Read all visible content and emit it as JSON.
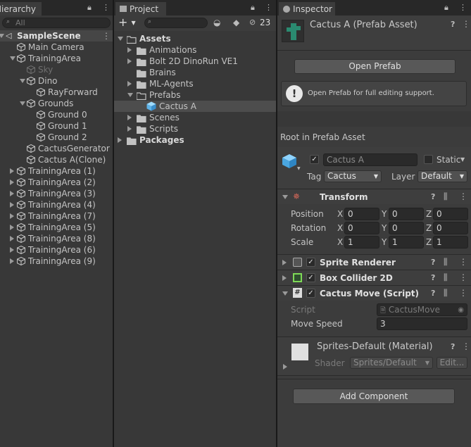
{
  "hierarchy": {
    "tab_title": "Hierarchy",
    "search_placeholder": "All",
    "scene_name": "SampleScene",
    "items": [
      {
        "label": "Main Camera",
        "indent": 1,
        "arrow": "",
        "dim": false
      },
      {
        "label": "TrainingArea",
        "indent": 1,
        "arrow": "down",
        "dim": false
      },
      {
        "label": "Sky",
        "indent": 2,
        "arrow": "",
        "dim": true
      },
      {
        "label": "Dino",
        "indent": 2,
        "arrow": "down",
        "dim": false
      },
      {
        "label": "RayForward",
        "indent": 3,
        "arrow": "",
        "dim": false
      },
      {
        "label": "Grounds",
        "indent": 2,
        "arrow": "down",
        "dim": false
      },
      {
        "label": "Ground 0",
        "indent": 3,
        "arrow": "",
        "dim": false
      },
      {
        "label": "Ground 1",
        "indent": 3,
        "arrow": "",
        "dim": false
      },
      {
        "label": "Ground 2",
        "indent": 3,
        "arrow": "",
        "dim": false
      },
      {
        "label": "CactusGenerator",
        "indent": 2,
        "arrow": "",
        "dim": false
      },
      {
        "label": "Cactus A(Clone)",
        "indent": 2,
        "arrow": "",
        "dim": false
      },
      {
        "label": "TrainingArea (1)",
        "indent": 1,
        "arrow": "right",
        "dim": false
      },
      {
        "label": "TrainingArea (2)",
        "indent": 1,
        "arrow": "right",
        "dim": false
      },
      {
        "label": "TrainingArea (3)",
        "indent": 1,
        "arrow": "right",
        "dim": false
      },
      {
        "label": "TrainingArea (4)",
        "indent": 1,
        "arrow": "right",
        "dim": false
      },
      {
        "label": "TrainingArea (7)",
        "indent": 1,
        "arrow": "right",
        "dim": false
      },
      {
        "label": "TrainingArea (5)",
        "indent": 1,
        "arrow": "right",
        "dim": false
      },
      {
        "label": "TrainingArea (8)",
        "indent": 1,
        "arrow": "right",
        "dim": false
      },
      {
        "label": "TrainingArea (6)",
        "indent": 1,
        "arrow": "right",
        "dim": false
      },
      {
        "label": "TrainingArea (9)",
        "indent": 1,
        "arrow": "right",
        "dim": false
      }
    ]
  },
  "project": {
    "tab_title": "Project",
    "add_label": "+",
    "hidden_count": "23",
    "items": [
      {
        "label": "Assets",
        "indent": 0,
        "arrow": "down",
        "icon": "folder-open",
        "bold": true,
        "selected": false
      },
      {
        "label": "Animations",
        "indent": 1,
        "arrow": "right",
        "icon": "folder",
        "bold": false,
        "selected": false
      },
      {
        "label": "Bolt 2D DinoRun VE1",
        "indent": 1,
        "arrow": "right",
        "icon": "folder",
        "bold": false,
        "selected": false
      },
      {
        "label": "Brains",
        "indent": 1,
        "arrow": "",
        "icon": "folder",
        "bold": false,
        "selected": false
      },
      {
        "label": "ML-Agents",
        "indent": 1,
        "arrow": "right",
        "icon": "folder",
        "bold": false,
        "selected": false
      },
      {
        "label": "Prefabs",
        "indent": 1,
        "arrow": "down",
        "icon": "folder-open",
        "bold": false,
        "selected": false
      },
      {
        "label": "Cactus A",
        "indent": 2,
        "arrow": "",
        "icon": "prefab",
        "bold": false,
        "selected": true
      },
      {
        "label": "Scenes",
        "indent": 1,
        "arrow": "right",
        "icon": "folder",
        "bold": false,
        "selected": false
      },
      {
        "label": "Scripts",
        "indent": 1,
        "arrow": "right",
        "icon": "folder",
        "bold": false,
        "selected": false
      },
      {
        "label": "Packages",
        "indent": 0,
        "arrow": "right",
        "icon": "folder",
        "bold": true,
        "selected": false
      }
    ]
  },
  "inspector": {
    "tab_title": "Inspector",
    "asset_title": "Cactus A (Prefab Asset)",
    "open_prefab_label": "Open Prefab",
    "info_text": "Open Prefab for full editing support.",
    "root_label": "Root in Prefab Asset",
    "object_name": "Cactus A",
    "static_label": "Static",
    "tag_label": "Tag",
    "tag_value": "Cactus",
    "layer_label": "Layer",
    "layer_value": "Default",
    "transform": {
      "title": "Transform",
      "rows": [
        {
          "label": "Position",
          "x": "0",
          "y": "0",
          "z": "0"
        },
        {
          "label": "Rotation",
          "x": "0",
          "y": "0",
          "z": "0"
        },
        {
          "label": "Scale",
          "x": "1",
          "y": "1",
          "z": "1"
        }
      ],
      "axis_x": "X",
      "axis_y": "Y",
      "axis_z": "Z"
    },
    "sprite_renderer": "Sprite Renderer",
    "box_collider": "Box Collider 2D",
    "cactus_move": {
      "title": "Cactus Move (Script)",
      "script_label": "Script",
      "script_value": "CactusMove",
      "speed_label": "Move Speed",
      "speed_value": "3"
    },
    "material": {
      "title": "Sprites-Default (Material)",
      "shader_label": "Shader",
      "shader_value": "Sprites/Default",
      "edit_label": "Edit..."
    },
    "add_component_label": "Add Component"
  },
  "colors": {
    "panel": "#383838",
    "selected": "#4d4d4d",
    "prefab_blue": "#5fb3e8"
  }
}
